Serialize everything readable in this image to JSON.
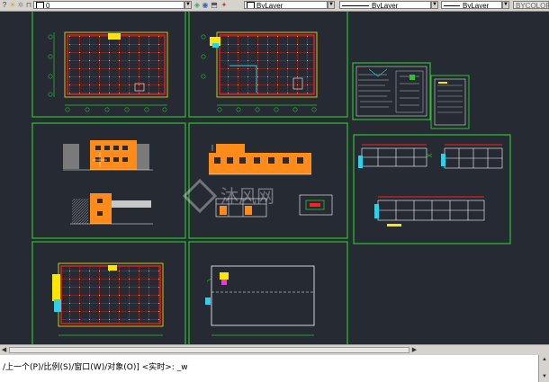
{
  "toolbar": {
    "layer_icons": [
      "lightbulb-icon",
      "sun-icon",
      "lock-icon",
      "color-square-icon"
    ],
    "layer_name": "0",
    "color_value": "ByLayer",
    "linetype_value": "ByLayer",
    "lineweight_value": "ByLayer",
    "plotstyle_value": "BYCOLOR"
  },
  "command": {
    "text": "/上一个(P)/比例(S)/窗口(W)/对象(O)] <实时>: _w"
  },
  "watermark": {
    "text": "沐风网"
  },
  "colors": {
    "canvas": "#252a33",
    "frame": "#2fc12f",
    "red_grid": "#ff1e1e",
    "yellow": "#ffe600",
    "orange": "#ff8c1a",
    "cyan": "#2fd0e8",
    "magenta": "#e040e0"
  }
}
